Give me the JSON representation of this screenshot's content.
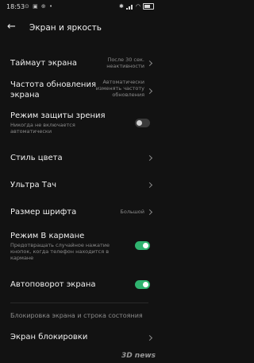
{
  "status_bar": {
    "time": "18:53",
    "notifications": "⊙ ▣ ⊕ •",
    "battery_icon": "battery-icon"
  },
  "header": {
    "title": "Экран и яркость"
  },
  "items": [
    {
      "label": "Таймаут экрана",
      "value": "После 30 сек.\nнеактивности"
    },
    {
      "label": "Частота обновления\nэкрана",
      "value": "Автоматически\nизменять частоту\nобновления"
    },
    {
      "label": "Режим защиты зрения",
      "sub": "Никогда не включается\nавтоматически",
      "toggle": false
    },
    {
      "label": "Стиль цвета"
    },
    {
      "label": "Ультра Тач"
    },
    {
      "label": "Размер шрифта",
      "value": "Большой"
    },
    {
      "label": "Режим В кармане",
      "sub": "Предотвращать случайное нажатие\nкнопок, когда телефон находится в\nкармане",
      "toggle": true
    },
    {
      "label": "Автоповорот экрана",
      "toggle": true
    }
  ],
  "section": {
    "title": "Блокировка экрана и строка состояния"
  },
  "lock_item": {
    "label": "Экран блокировки"
  },
  "watermark": "3D news",
  "colors": {
    "accent": "#2fb36f",
    "background": "#121212"
  }
}
